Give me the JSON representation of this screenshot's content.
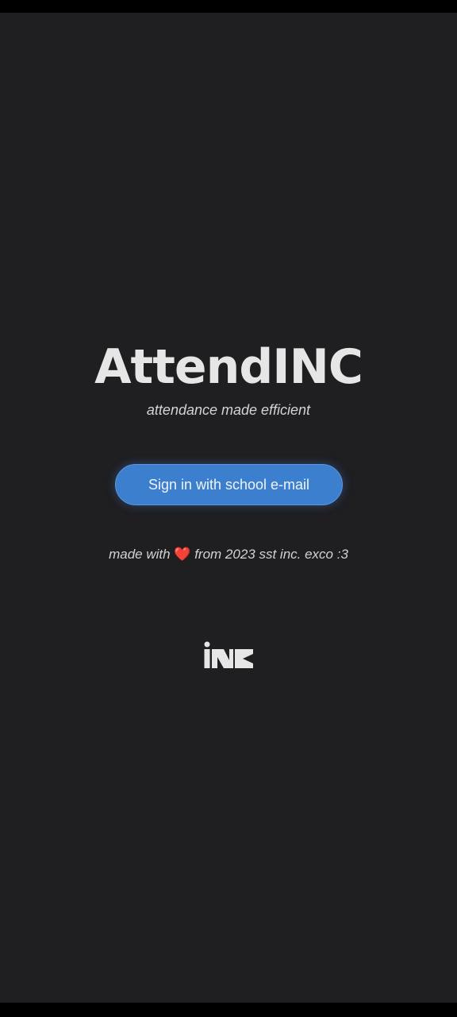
{
  "app": {
    "title": "AttendINC",
    "subtitle": "attendance made efficient"
  },
  "signin": {
    "label": "Sign in with school e-mail"
  },
  "credit": {
    "prefix": "made with",
    "heart": "❤️",
    "suffix": "from 2023 sst inc. exco :3"
  },
  "logo": {
    "text": "iNC",
    "icon": "inc-logo"
  },
  "colors": {
    "background": "#1f1e21",
    "accent": "#3d7fcf",
    "heart": "#e2353b"
  }
}
